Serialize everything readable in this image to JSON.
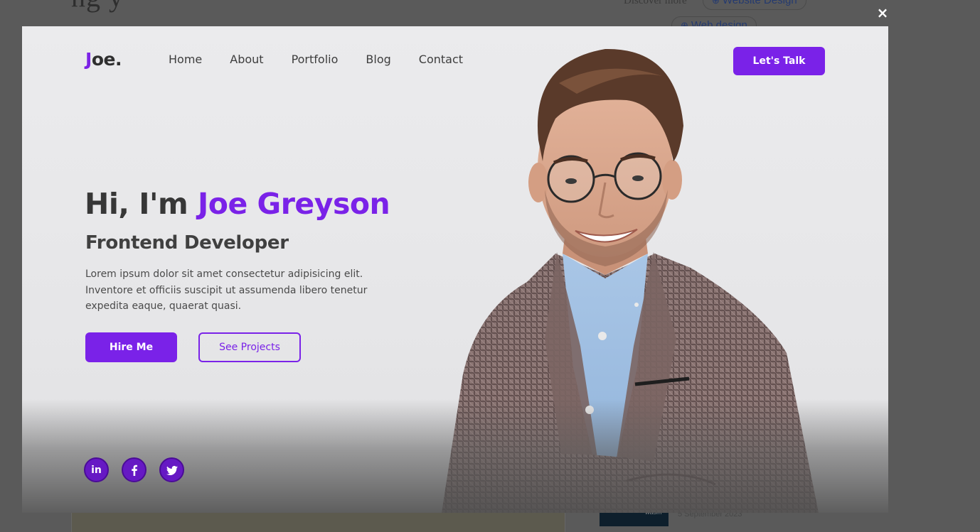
{
  "background_page": {
    "heading": "ng                          y",
    "discover_label": "Discover more",
    "chips": [
      "Website Design",
      "Web design"
    ],
    "date": "5 September 2023",
    "thumb_text": "wasm"
  },
  "lightbox": {
    "close_icon": "×"
  },
  "site": {
    "logo": {
      "accent": "J",
      "rest": "oe."
    },
    "nav": [
      "Home",
      "About",
      "Portfolio",
      "Blog",
      "Contact"
    ],
    "cta": "Let's Talk"
  },
  "hero": {
    "greeting_prefix": "Hi, I'm ",
    "name": "Joe Greyson",
    "role": "Frontend Developer",
    "bio": "Lorem ipsum dolor sit amet consectetur adipisicing elit. Inventore et officiis suscipit ut assumenda libero tenetur expedita eaque, quaerat quasi.",
    "primary_button": "Hire Me",
    "secondary_button": "See Projects"
  },
  "socials": [
    "linkedin-icon",
    "facebook-icon",
    "twitter-icon"
  ],
  "colors": {
    "accent": "#7a22e8",
    "text_dark": "#373737",
    "overlay": "#5a5a5a",
    "hero_bg": "#e8e8ea"
  }
}
